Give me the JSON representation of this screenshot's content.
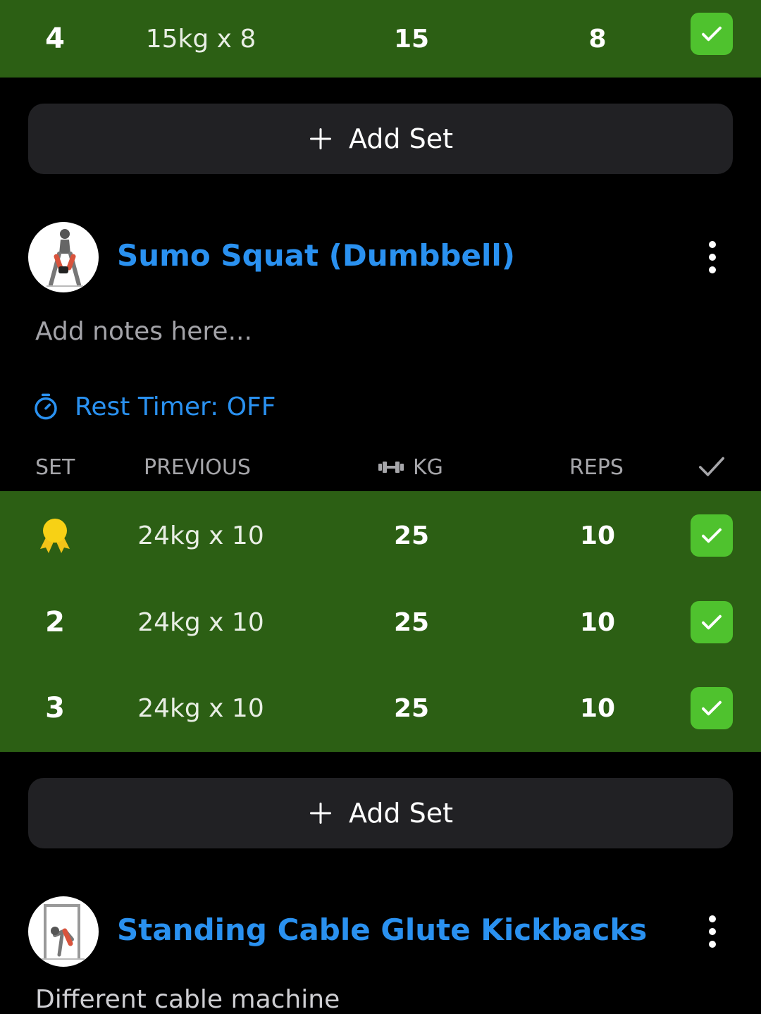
{
  "colors": {
    "background": "#000000",
    "completed_row": "#2c5f14",
    "check_green": "#4fc22e",
    "accent_blue": "#2a91f0",
    "button_bg": "#212124"
  },
  "top_row": {
    "set": "4",
    "previous": "15kg x 8",
    "kg": "15",
    "reps": "8",
    "done_icon": "check-icon"
  },
  "add_set_label": "Add Set",
  "exercise1": {
    "title": "Sumo Squat (Dumbbell)",
    "notes_placeholder": "Add notes here...",
    "rest_timer": "Rest Timer: OFF",
    "headers": {
      "set": "SET",
      "previous": "PREVIOUS",
      "kg": "KG",
      "reps": "REPS"
    },
    "sets": [
      {
        "set": "",
        "set_icon": "medal-icon",
        "previous": "24kg x 10",
        "kg": "25",
        "reps": "10"
      },
      {
        "set": "2",
        "previous": "24kg x 10",
        "kg": "25",
        "reps": "10"
      },
      {
        "set": "3",
        "previous": "24kg x 10",
        "kg": "25",
        "reps": "10"
      }
    ]
  },
  "exercise2": {
    "title": "Standing Cable Glute Kickbacks",
    "notes_partial": "Different cable machine"
  }
}
